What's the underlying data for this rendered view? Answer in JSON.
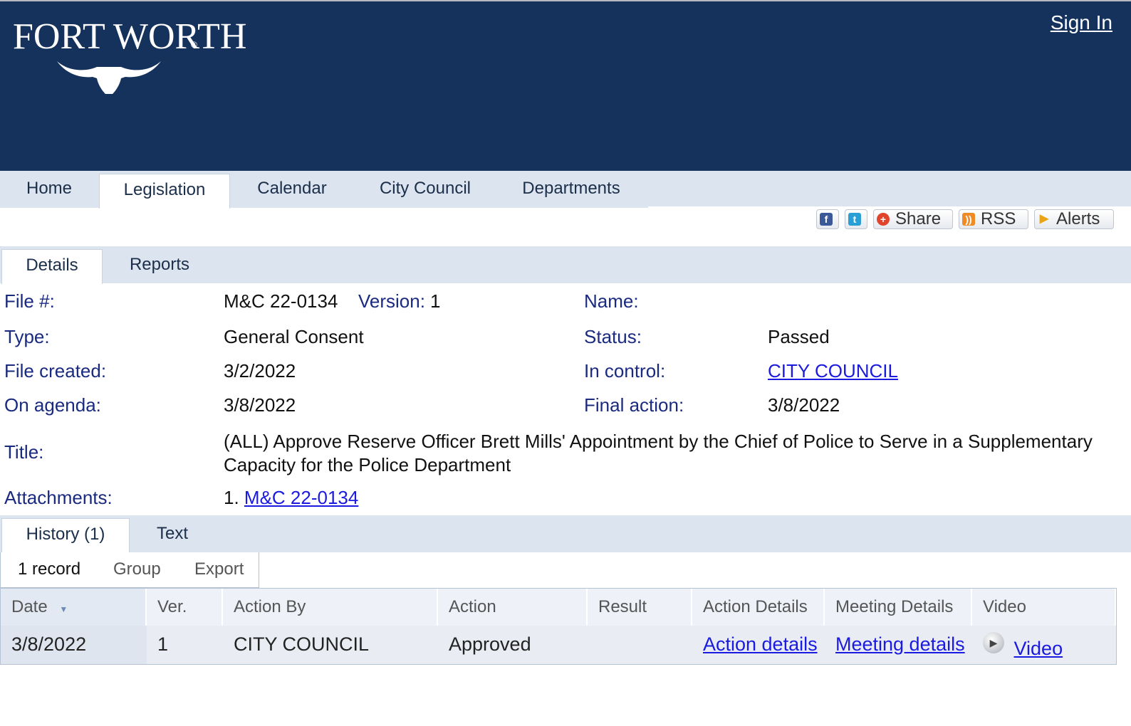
{
  "header": {
    "logo_text": "FORT WORTH",
    "logo_registered": "®",
    "sign_in": "Sign In"
  },
  "nav": {
    "tabs": [
      {
        "label": "Home"
      },
      {
        "label": "Legislation",
        "active": true
      },
      {
        "label": "Calendar"
      },
      {
        "label": "City Council"
      },
      {
        "label": "Departments"
      }
    ]
  },
  "social": {
    "share": "Share",
    "rss": "RSS",
    "alerts": "Alerts"
  },
  "subtabs": [
    {
      "label": "Details",
      "active": true
    },
    {
      "label": "Reports"
    }
  ],
  "details": {
    "file_label": "File #:",
    "file_value": "M&C 22-0134",
    "version_label": "Version:",
    "version_value": "1",
    "name_label": "Name:",
    "name_value": "",
    "type_label": "Type:",
    "type_value": "General Consent",
    "status_label": "Status:",
    "status_value": "Passed",
    "created_label": "File created:",
    "created_value": "3/2/2022",
    "control_label": "In control:",
    "control_value": "CITY COUNCIL",
    "agenda_label": "On agenda:",
    "agenda_value": "3/8/2022",
    "final_label": "Final action:",
    "final_value": "3/8/2022",
    "title_label": "Title:",
    "title_value": "(ALL) Approve Reserve Officer Brett Mills' Appointment by the Chief of Police to Serve in a Supplementary Capacity for the Police Department",
    "attachments_label": "Attachments:",
    "attachment_index": "1.",
    "attachment_link": "M&C 22-0134"
  },
  "history_tabs": [
    {
      "label": "History (1)",
      "active": true
    },
    {
      "label": "Text"
    }
  ],
  "history_toolbar": {
    "records": "1 record",
    "group": "Group",
    "export": "Export"
  },
  "history_table": {
    "columns": [
      "Date",
      "Ver.",
      "Action By",
      "Action",
      "Result",
      "Action Details",
      "Meeting Details",
      "Video"
    ],
    "rows": [
      {
        "date": "3/8/2022",
        "ver": "1",
        "action_by": "CITY COUNCIL",
        "action": "Approved",
        "result": "",
        "action_details": "Action details",
        "meeting_details": "Meeting details",
        "video": "Video"
      }
    ]
  },
  "colors": {
    "header_bg": "#14325c",
    "tab_bg": "#dce4ef",
    "label_blue": "#1a2a80",
    "link_blue": "#1a1ae0"
  }
}
